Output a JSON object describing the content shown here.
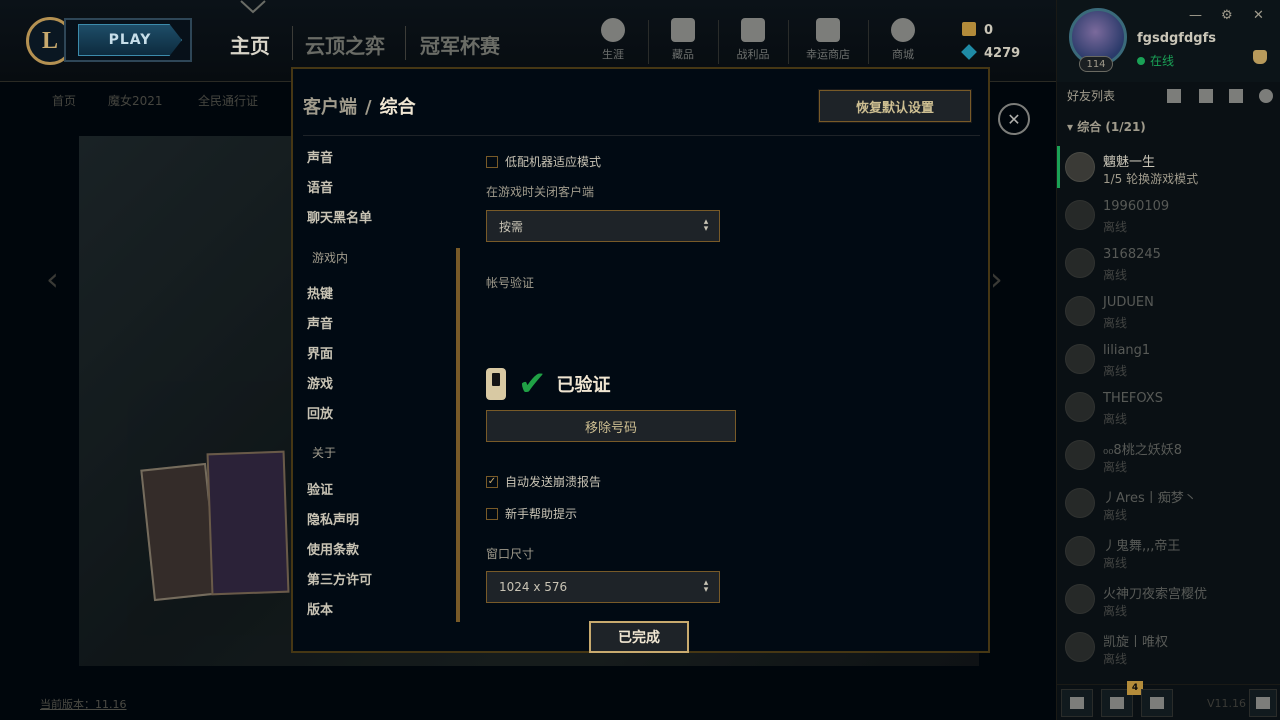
{
  "topbar": {
    "logo_letter": "L",
    "play_label": "PLAY",
    "tabs": [
      {
        "label": "主页",
        "active": true
      },
      {
        "label": "云顶之弈",
        "active": false
      },
      {
        "label": "冠军杯赛",
        "active": false
      }
    ],
    "icon_tabs": [
      {
        "label": "生涯",
        "icon": "profile-icon"
      },
      {
        "label": "藏品",
        "icon": "collection-icon"
      },
      {
        "label": "战利品",
        "icon": "loot-icon"
      },
      {
        "label": "幸运商店",
        "icon": "lucky-shop-icon"
      },
      {
        "label": "商城",
        "icon": "store-icon"
      }
    ],
    "rp": "0",
    "be": "4279",
    "subnav": [
      "首页",
      "魔女2021",
      "全民通行证"
    ]
  },
  "profile": {
    "name": "fgsdgfdgfs",
    "status": "在线",
    "level": "114"
  },
  "modal": {
    "breadcrumb": "客户端",
    "separator": "/",
    "current": "综合",
    "reset_label": "恢复默认设置",
    "done_label": "已完成",
    "sidebar": {
      "top_items": [
        "声音",
        "语音",
        "聊天黑名单"
      ],
      "ingame_group": "游戏内",
      "ingame_items": [
        "热键",
        "声音",
        "界面",
        "游戏",
        "回放"
      ],
      "about_group": "关于",
      "about_items": [
        "验证",
        "隐私声明",
        "使用条款",
        "第三方许可",
        "版本"
      ]
    },
    "settings": {
      "low_spec_label": "低配机器适应模式",
      "low_spec_checked": false,
      "close_client_label": "在游戏时关闭客户端",
      "close_client_value": "按需",
      "account_verify_label": "帐号验证",
      "verified_label": "已验证",
      "remove_number_label": "移除号码",
      "crash_report_label": "自动发送崩溃报告",
      "crash_report_checked": true,
      "tutorial_tips_label": "新手帮助提示",
      "tutorial_tips_checked": false,
      "window_size_label": "窗口尺寸",
      "window_size_value": "1024 x 576"
    }
  },
  "friends": {
    "header": "好友列表",
    "group": "综合 (1/21)",
    "list": [
      {
        "name": "魑魅一生",
        "status": "1/5 轮换游戏模式",
        "active": true
      },
      {
        "name": "19960109",
        "status": "离线",
        "active": false
      },
      {
        "name": "3168245",
        "status": "离线",
        "active": false
      },
      {
        "name": "JUDUEN",
        "status": "离线",
        "active": false
      },
      {
        "name": "liliang1",
        "status": "离线",
        "active": false
      },
      {
        "name": "THEFOXS",
        "status": "离线",
        "active": false
      },
      {
        "name": "₀₀8桃之妖妖8",
        "status": "离线",
        "active": false
      },
      {
        "name": "丿Ares丨痴梦丶",
        "status": "离线",
        "active": false
      },
      {
        "name": "丿鬼舞,,,帝王",
        "status": "离线",
        "active": false
      },
      {
        "name": "火神刀夜索宫樱优",
        "status": "离线",
        "active": false
      },
      {
        "name": "凯旋丨唯权",
        "status": "离线",
        "active": false
      }
    ],
    "badge_count": "4",
    "version": "V11.16"
  },
  "bottom_left": "当前版本：11.16"
}
